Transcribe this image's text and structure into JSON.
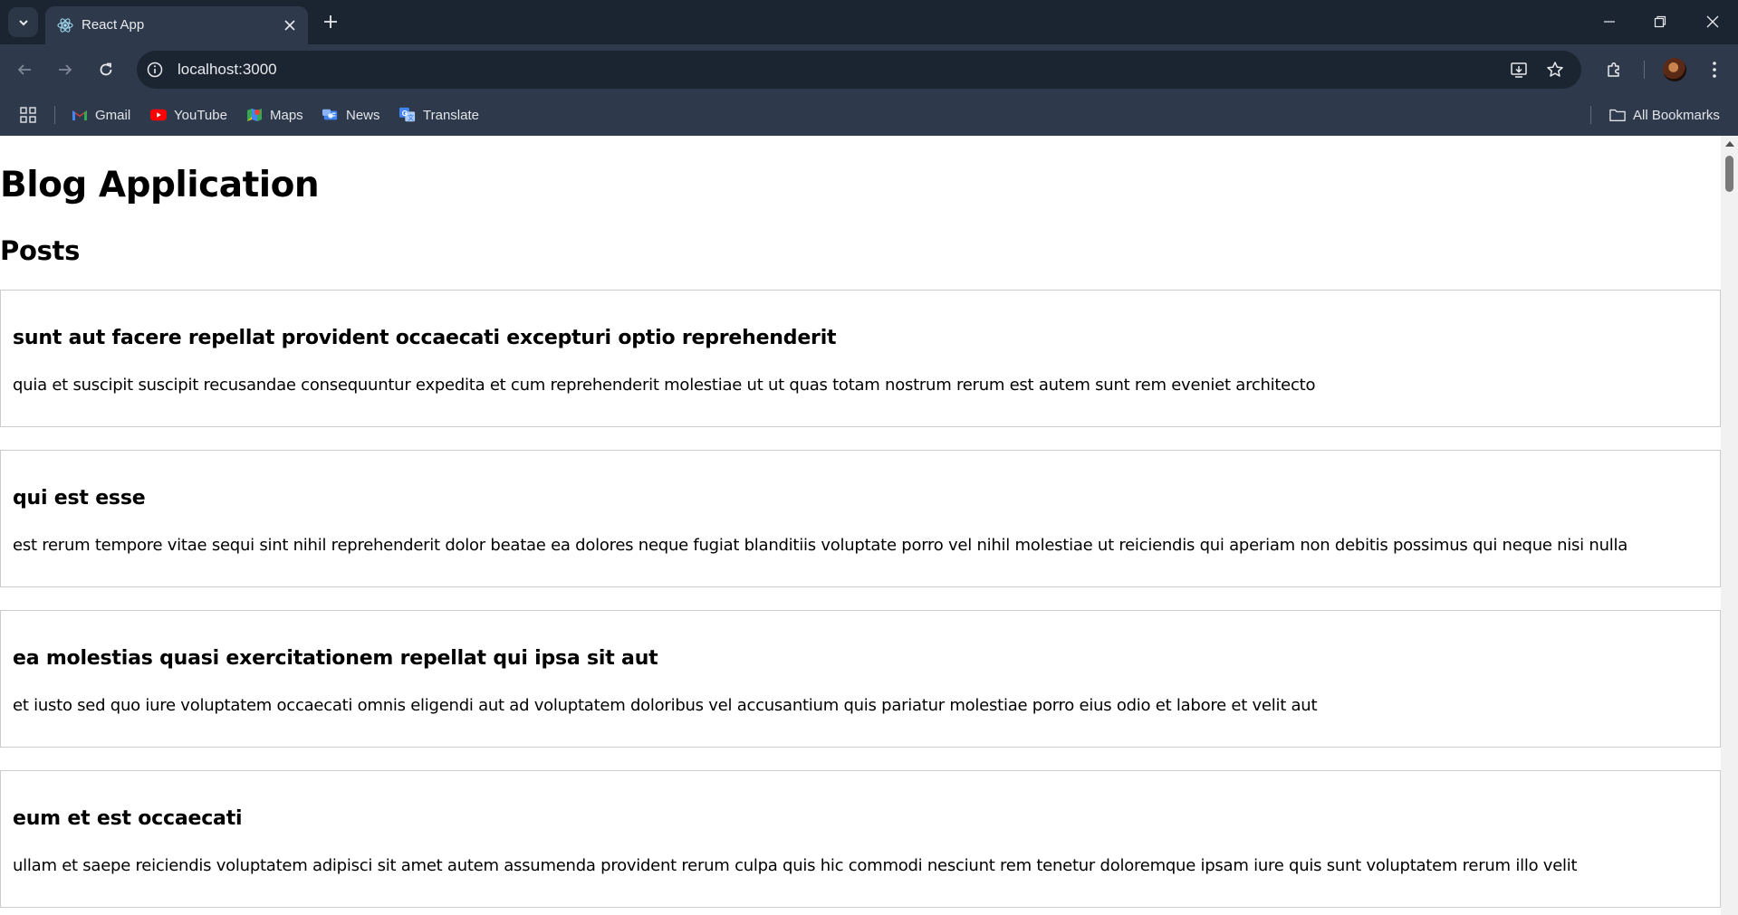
{
  "browser": {
    "tab_title": "React App",
    "url": "localhost:3000",
    "bookmarks": [
      {
        "label": "Gmail",
        "icon": "gmail-icon"
      },
      {
        "label": "YouTube",
        "icon": "youtube-icon"
      },
      {
        "label": "Maps",
        "icon": "maps-icon"
      },
      {
        "label": "News",
        "icon": "news-icon"
      },
      {
        "label": "Translate",
        "icon": "translate-icon"
      }
    ],
    "all_bookmarks_label": "All Bookmarks"
  },
  "page": {
    "title": "Blog Application",
    "section": "Posts",
    "posts": [
      {
        "title": "sunt aut facere repellat provident occaecati excepturi optio reprehenderit",
        "body": "quia et suscipit suscipit recusandae consequuntur expedita et cum reprehenderit molestiae ut ut quas totam nostrum rerum est autem sunt rem eveniet architecto"
      },
      {
        "title": "qui est esse",
        "body": "est rerum tempore vitae sequi sint nihil reprehenderit dolor beatae ea dolores neque fugiat blanditiis voluptate porro vel nihil molestiae ut reiciendis qui aperiam non debitis possimus qui neque nisi nulla"
      },
      {
        "title": "ea molestias quasi exercitationem repellat qui ipsa sit aut",
        "body": "et iusto sed quo iure voluptatem occaecati omnis eligendi aut ad voluptatem doloribus vel accusantium quis pariatur molestiae porro eius odio et labore et velit aut"
      },
      {
        "title": "eum et est occaecati",
        "body": "ullam et saepe reiciendis voluptatem adipisci sit amet autem assumenda provident rerum culpa quis hic commodi nesciunt rem tenetur doloremque ipsam iure quis sunt voluptatem rerum illo velit"
      }
    ]
  },
  "colors": {
    "chrome_bg": "#1f2937",
    "toolbar_bg": "#2e3a4c",
    "omnibox_bg": "#1b2431",
    "post_border": "#cccccc"
  }
}
